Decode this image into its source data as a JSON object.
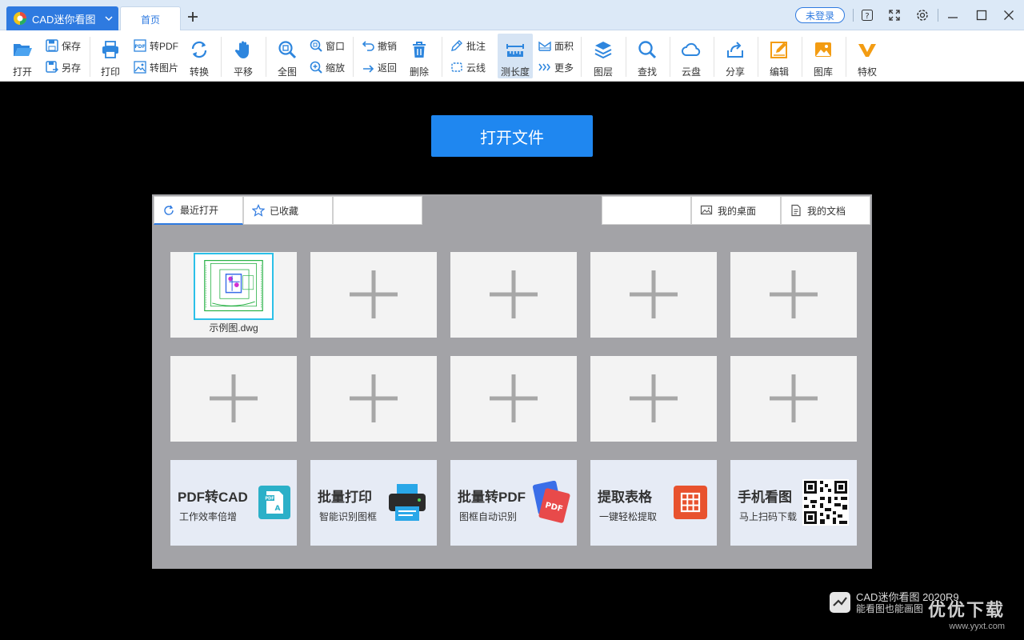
{
  "titlebar": {
    "app_name": "CAD迷你看图",
    "home_tab": "首页",
    "login": "未登录"
  },
  "toolbar": {
    "open": "打开",
    "save": "保存",
    "save_as": "另存",
    "print": "打印",
    "to_pdf": "转PDF",
    "to_image": "转图片",
    "convert": "转换",
    "pan": "平移",
    "fit_all": "全图",
    "window": "窗口",
    "zoom": "缩放",
    "undo": "撤销",
    "back": "返回",
    "delete": "删除",
    "annotate": "批注",
    "cloud_line": "云线",
    "measure": "测长度",
    "area": "面积",
    "more": "更多",
    "layers": "图层",
    "find": "查找",
    "cloud_disk": "云盘",
    "share": "分享",
    "edit": "编辑",
    "library": "图库",
    "privilege": "特权"
  },
  "main": {
    "open_file": "打开文件",
    "tabs": {
      "recent": "最近打开",
      "favorites": "已收藏",
      "desktop": "我的桌面",
      "documents": "我的文档"
    },
    "recent_file": "示例图.dwg",
    "promos": [
      {
        "title": "PDF转CAD",
        "subtitle": "工作效率倍增"
      },
      {
        "title": "批量打印",
        "subtitle": "智能识别图框"
      },
      {
        "title": "批量转PDF",
        "subtitle": "图框自动识别"
      },
      {
        "title": "提取表格",
        "subtitle": "一键轻松提取"
      },
      {
        "title": "手机看图",
        "subtitle": "马上扫码下载"
      }
    ],
    "promo_pdf_badge": "PDF"
  },
  "brand": {
    "name": "CAD迷你看图",
    "version": "2020R9",
    "tagline": "能看图也能画图"
  },
  "site_watermark": {
    "text": "优优下载",
    "url": "www.yyxt.com"
  },
  "colors": {
    "accent": "#1f87f0",
    "app_tab": "#2e7ae0",
    "panel_bg": "#a3a3a7",
    "thumb_bg": "#f3f3f3"
  }
}
